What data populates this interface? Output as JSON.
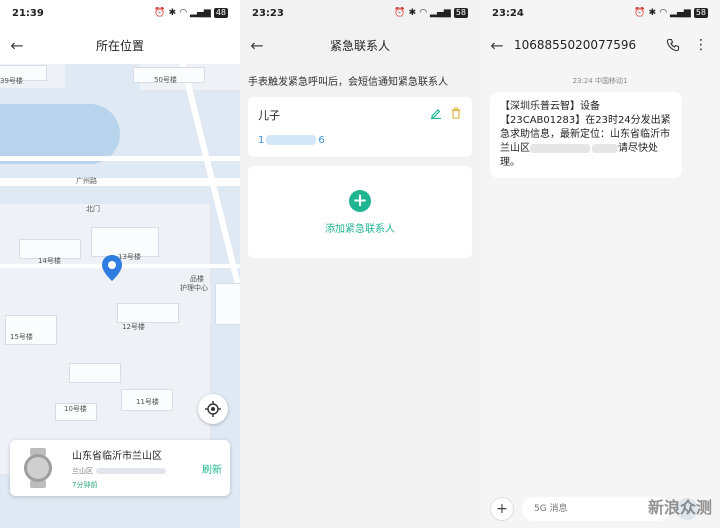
{
  "panels": {
    "location": {
      "status": {
        "time": "21:39",
        "battery": "48"
      },
      "title": "所在位置",
      "map_labels": [
        "39号楼",
        "50号楼",
        "北门",
        "13号楼",
        "14号楼",
        "品楼",
        "护理中心",
        "12号楼",
        "15号楼",
        "11号楼",
        "10号楼",
        "广州路"
      ],
      "card": {
        "address": "山东省临沂市兰山区",
        "sub_prefix": "兰山区",
        "time_ago": "7分钟前",
        "refresh_label": "刷新"
      }
    },
    "contacts": {
      "status": {
        "time": "23:23",
        "battery": "58"
      },
      "title": "紧急联系人",
      "notice": "手表触发紧急呼叫后，会短信通知紧急联系人",
      "contact": {
        "name": "儿子",
        "phone_start": "1",
        "phone_end": "6"
      },
      "add_label": "添加紧急联系人"
    },
    "sms": {
      "status": {
        "time": "23:24",
        "battery": "58"
      },
      "sender": "1068855020077596",
      "meta": "23:24 中国移动1",
      "message_a": "【深圳乐普云智】设备【23CAB01283】在23时24分发出紧急求助信息，最新定位：山东省临沂市兰山区",
      "message_b": "请尽快处理。",
      "input_placeholder": "5G 消息",
      "watermark": "新浪众测"
    }
  },
  "colors": {
    "accent": "#1fb492",
    "map_bg": "#dfe9f3",
    "water": "#b8d3ec"
  }
}
